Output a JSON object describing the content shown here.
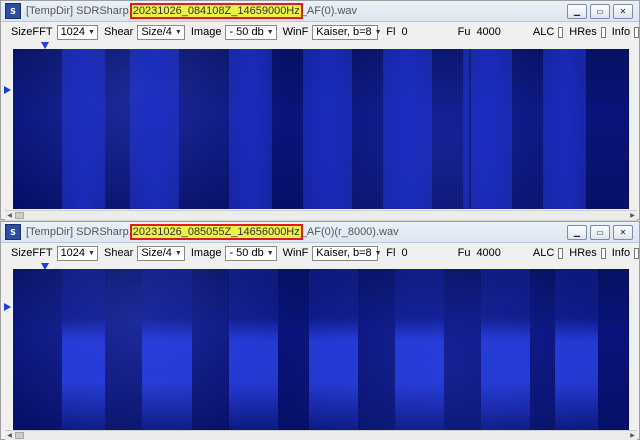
{
  "windows": [
    {
      "title_prefix": "[TempDir] SDRSharp.",
      "title_highlight": "20231026_084108Z_14659000Hz",
      "title_suffix": "_AF(0).wav",
      "toolbar": {
        "sizefft_label": "SizeFFT",
        "sizefft_value": "1024",
        "shear_label": "Shear",
        "shear_value": "Size/4",
        "image_label": "Image",
        "image_value": "- 50 db",
        "winf_label": "WinF",
        "winf_value": "Kaiser, b=8",
        "fl_label": "Fl",
        "fl_value": "0",
        "fu_label": "Fu",
        "fu_value": "4000",
        "alc_label": "ALC",
        "hres_label": "HRes",
        "info_label": "Info"
      }
    },
    {
      "title_prefix": "[TempDir] SDRSharp.",
      "title_highlight": "20231026_085055Z_14656000Hz",
      "title_suffix": "_AF(0)(r_8000).wav",
      "toolbar": {
        "sizefft_label": "SizeFFT",
        "sizefft_value": "1024",
        "shear_label": "Shear",
        "shear_value": "Size/4",
        "image_label": "Image",
        "image_value": "- 50 db",
        "winf_label": "WinF",
        "winf_value": "Kaiser, b=8",
        "fl_label": "Fl",
        "fl_value": "0",
        "fu_label": "Fu",
        "fu_value": "4000",
        "alc_label": "ALC",
        "hres_label": "HRes",
        "info_label": "Info"
      }
    }
  ],
  "icons": {
    "app": "sdrsharp-app-icon",
    "minimize": "minimize-icon",
    "maximize": "maximize-icon",
    "close": "close-icon",
    "marker_top": "triangle-down-icon",
    "marker_left": "triangle-right-icon"
  },
  "colors": {
    "highlight_fill": "#eaf24a",
    "highlight_border": "#e21b1b",
    "spectrogram_dark": "#08127a",
    "spectrogram_band": "#2d46e8",
    "marker": "#1d3fe0"
  }
}
